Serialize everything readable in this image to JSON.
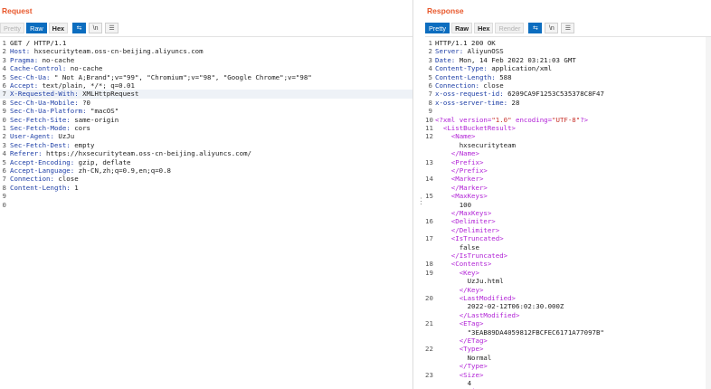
{
  "request": {
    "title": "Request",
    "tabs": [
      "Pretty",
      "Raw",
      "Hex"
    ],
    "active_tab": "Raw",
    "icons": [
      "wrap-lines-icon",
      "newline-icon",
      "menu-icon"
    ],
    "icon_glyphs": [
      "⇆",
      "\\n",
      "☰"
    ],
    "lines": [
      {
        "n": "1",
        "k": "",
        "v": "GET / HTTP/1.1"
      },
      {
        "n": "2",
        "k": "Host:",
        "v": " hxsecurityteam.oss-cn-beijing.aliyuncs.com"
      },
      {
        "n": "3",
        "k": "Pragma:",
        "v": " no-cache"
      },
      {
        "n": "4",
        "k": "Cache-Control:",
        "v": " no-cache"
      },
      {
        "n": "5",
        "k": "Sec-Ch-Ua:",
        "v": " \" Not A;Brand\";v=\"99\", \"Chromium\";v=\"98\", \"Google Chrome\";v=\"98\""
      },
      {
        "n": "6",
        "k": "Accept:",
        "v": " text/plain, */*; q=0.01"
      },
      {
        "n": "7",
        "k": "X-Requested-With:",
        "v": " XMLHttpRequest"
      },
      {
        "n": "8",
        "k": "Sec-Ch-Ua-Mobile:",
        "v": " ?0"
      },
      {
        "n": "9",
        "k": "Sec-Ch-Ua-Platform:",
        "v": " \"macOS\""
      },
      {
        "n": "0",
        "k": "Sec-Fetch-Site:",
        "v": " same-origin"
      },
      {
        "n": "1",
        "k": "Sec-Fetch-Mode:",
        "v": " cors"
      },
      {
        "n": "2",
        "k": "User-Agent:",
        "v": " UzJu"
      },
      {
        "n": "3",
        "k": "Sec-Fetch-Dest:",
        "v": " empty"
      },
      {
        "n": "4",
        "k": "Referer:",
        "v": " https://hxsecurityteam.oss-cn-beijing.aliyuncs.com/"
      },
      {
        "n": "5",
        "k": "Accept-Encoding:",
        "v": " gzip, deflate"
      },
      {
        "n": "6",
        "k": "Accept-Language:",
        "v": " zh-CN,zh;q=0.9,en;q=0.8"
      },
      {
        "n": "7",
        "k": "Connection:",
        "v": " close"
      },
      {
        "n": "8",
        "k": "Content-Length:",
        "v": " 1"
      },
      {
        "n": "9",
        "k": "",
        "v": ""
      },
      {
        "n": "0",
        "k": "",
        "v": ""
      }
    ]
  },
  "response": {
    "title": "Response",
    "tabs": [
      "Pretty",
      "Raw",
      "Hex",
      "Render"
    ],
    "active_tab": "Pretty",
    "icons": [
      "wrap-lines-icon",
      "newline-icon",
      "menu-icon"
    ],
    "icon_glyphs": [
      "⇆",
      "\\n",
      "☰"
    ],
    "lines": [
      {
        "n": "1",
        "parts": [
          [
            "plain",
            "HTTP/1.1 200 OK"
          ]
        ]
      },
      {
        "n": "2",
        "parts": [
          [
            "hkey",
            "Server:"
          ],
          [
            "plain",
            " AliyunOSS"
          ]
        ]
      },
      {
        "n": "3",
        "parts": [
          [
            "hkey",
            "Date:"
          ],
          [
            "plain",
            " Mon, 14 Feb 2022 03:21:03 GMT"
          ]
        ]
      },
      {
        "n": "4",
        "parts": [
          [
            "hkey",
            "Content-Type:"
          ],
          [
            "plain",
            " application/xml"
          ]
        ]
      },
      {
        "n": "5",
        "parts": [
          [
            "hkey",
            "Content-Length:"
          ],
          [
            "plain",
            " 588"
          ]
        ]
      },
      {
        "n": "6",
        "parts": [
          [
            "hkey",
            "Connection:"
          ],
          [
            "plain",
            " close"
          ]
        ]
      },
      {
        "n": "7",
        "parts": [
          [
            "hkey",
            "x-oss-request-id:"
          ],
          [
            "plain",
            " 6209CA9F1253C535378C8F47"
          ]
        ]
      },
      {
        "n": "8",
        "parts": [
          [
            "hkey",
            "x-oss-server-time:"
          ],
          [
            "plain",
            " 28"
          ]
        ]
      },
      {
        "n": "9",
        "parts": []
      },
      {
        "n": "10",
        "parts": [
          [
            "tag",
            "<?xml "
          ],
          [
            "attr",
            "version="
          ],
          [
            "aval",
            "\"1.0\""
          ],
          [
            "attr",
            " encoding="
          ],
          [
            "aval",
            "\"UTF-8\""
          ],
          [
            "tag",
            "?>"
          ]
        ]
      },
      {
        "n": "11",
        "parts": [
          [
            "tag",
            "  <ListBucketResult>"
          ]
        ]
      },
      {
        "n": "12",
        "parts": [
          [
            "tag",
            "    <Name>"
          ]
        ]
      },
      {
        "n": "",
        "parts": [
          [
            "plain",
            "      hxsecurityteam"
          ]
        ]
      },
      {
        "n": "",
        "parts": [
          [
            "tag",
            "    </Name>"
          ]
        ]
      },
      {
        "n": "13",
        "parts": [
          [
            "tag",
            "    <Prefix>"
          ]
        ]
      },
      {
        "n": "",
        "parts": [
          [
            "tag",
            "    </Prefix>"
          ]
        ]
      },
      {
        "n": "14",
        "parts": [
          [
            "tag",
            "    <Marker>"
          ]
        ]
      },
      {
        "n": "",
        "parts": [
          [
            "tag",
            "    </Marker>"
          ]
        ]
      },
      {
        "n": "15",
        "parts": [
          [
            "tag",
            "    <MaxKeys>"
          ]
        ]
      },
      {
        "n": "",
        "parts": [
          [
            "plain",
            "      100"
          ]
        ]
      },
      {
        "n": "",
        "parts": [
          [
            "tag",
            "    </MaxKeys>"
          ]
        ]
      },
      {
        "n": "16",
        "parts": [
          [
            "tag",
            "    <Delimiter>"
          ]
        ]
      },
      {
        "n": "",
        "parts": [
          [
            "tag",
            "    </Delimiter>"
          ]
        ]
      },
      {
        "n": "17",
        "parts": [
          [
            "tag",
            "    <IsTruncated>"
          ]
        ]
      },
      {
        "n": "",
        "parts": [
          [
            "plain",
            "      false"
          ]
        ]
      },
      {
        "n": "",
        "parts": [
          [
            "tag",
            "    </IsTruncated>"
          ]
        ]
      },
      {
        "n": "18",
        "parts": [
          [
            "tag",
            "    <Contents>"
          ]
        ]
      },
      {
        "n": "19",
        "parts": [
          [
            "tag",
            "      <Key>"
          ]
        ]
      },
      {
        "n": "",
        "parts": [
          [
            "plain",
            "        UzJu.html"
          ]
        ]
      },
      {
        "n": "",
        "parts": [
          [
            "tag",
            "      </Key>"
          ]
        ]
      },
      {
        "n": "20",
        "parts": [
          [
            "tag",
            "      <LastModified>"
          ]
        ]
      },
      {
        "n": "",
        "parts": [
          [
            "plain",
            "        2022-02-12T06:02:30.000Z"
          ]
        ]
      },
      {
        "n": "",
        "parts": [
          [
            "tag",
            "      </LastModified>"
          ]
        ]
      },
      {
        "n": "21",
        "parts": [
          [
            "tag",
            "      <ETag>"
          ]
        ]
      },
      {
        "n": "",
        "parts": [
          [
            "plain",
            "        \"3EAB89DA4059812FBCFEC6171A77097B\""
          ]
        ]
      },
      {
        "n": "",
        "parts": [
          [
            "tag",
            "      </ETag>"
          ]
        ]
      },
      {
        "n": "22",
        "parts": [
          [
            "tag",
            "      <Type>"
          ]
        ]
      },
      {
        "n": "",
        "parts": [
          [
            "plain",
            "        Normal"
          ]
        ]
      },
      {
        "n": "",
        "parts": [
          [
            "tag",
            "      </Type>"
          ]
        ]
      },
      {
        "n": "23",
        "parts": [
          [
            "tag",
            "      <Size>"
          ]
        ]
      },
      {
        "n": "",
        "parts": [
          [
            "plain",
            "        4"
          ]
        ]
      },
      {
        "n": "",
        "parts": [
          [
            "tag",
            "      </Size>"
          ]
        ]
      }
    ]
  },
  "divider": {
    "handle_glyph": "⋮"
  }
}
